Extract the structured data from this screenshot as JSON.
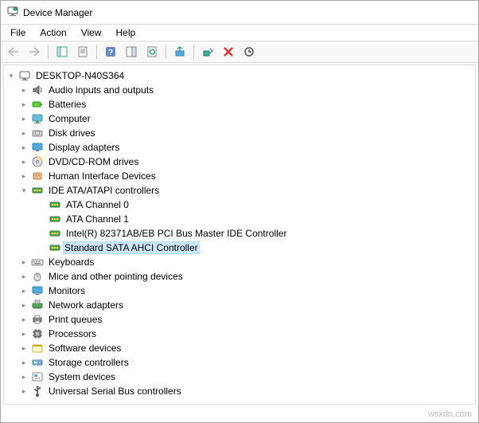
{
  "window": {
    "title": "Device Manager"
  },
  "menubar": {
    "file": "File",
    "action": "Action",
    "view": "View",
    "help": "Help"
  },
  "tree": {
    "root": "DESKTOP-N40S364",
    "nodes": [
      {
        "label": "Audio inputs and outputs",
        "icon": "audio"
      },
      {
        "label": "Batteries",
        "icon": "battery"
      },
      {
        "label": "Computer",
        "icon": "computer"
      },
      {
        "label": "Disk drives",
        "icon": "disk"
      },
      {
        "label": "Display adapters",
        "icon": "display"
      },
      {
        "label": "DVD/CD-ROM drives",
        "icon": "dvd"
      },
      {
        "label": "Human Interface Devices",
        "icon": "hid"
      },
      {
        "label": "IDE ATA/ATAPI controllers",
        "icon": "ide",
        "expanded": true,
        "children": [
          {
            "label": "ATA Channel 0",
            "icon": "ide"
          },
          {
            "label": "ATA Channel 1",
            "icon": "ide"
          },
          {
            "label": "Intel(R) 82371AB/EB PCI Bus Master IDE Controller",
            "icon": "ide"
          },
          {
            "label": "Standard SATA AHCI Controller",
            "icon": "ide",
            "selected": true
          }
        ]
      },
      {
        "label": "Keyboards",
        "icon": "keyboard"
      },
      {
        "label": "Mice and other pointing devices",
        "icon": "mouse"
      },
      {
        "label": "Monitors",
        "icon": "monitor"
      },
      {
        "label": "Network adapters",
        "icon": "network"
      },
      {
        "label": "Print queues",
        "icon": "printer"
      },
      {
        "label": "Processors",
        "icon": "cpu"
      },
      {
        "label": "Software devices",
        "icon": "software"
      },
      {
        "label": "Storage controllers",
        "icon": "storage"
      },
      {
        "label": "System devices",
        "icon": "system"
      },
      {
        "label": "Universal Serial Bus controllers",
        "icon": "usb"
      }
    ]
  },
  "watermark": "wsxdn.com"
}
